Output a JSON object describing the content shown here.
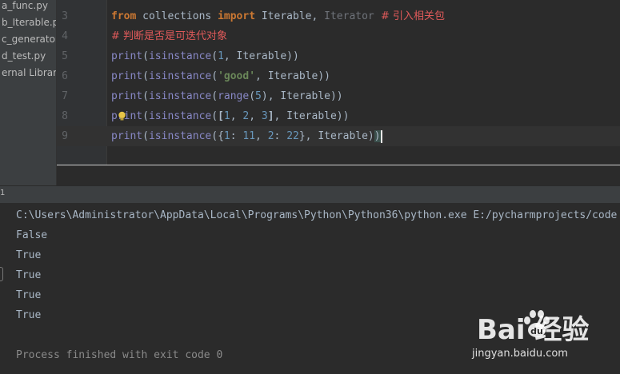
{
  "sidebar": {
    "items": [
      {
        "label": "a_func.py"
      },
      {
        "label": "b_Iterable.py"
      },
      {
        "label": "c_generator"
      },
      {
        "label": "d_test.py"
      },
      {
        "label": "ernal Librari"
      }
    ]
  },
  "editor": {
    "line_numbers": [
      "3",
      "4",
      "5",
      "6",
      "7",
      "8",
      "9"
    ],
    "lines": {
      "l3": {
        "kw1": "from",
        "mod": " collections ",
        "kw2": "import",
        "imp1": " Iterable",
        "sep": ", ",
        "imp2": "Iterator",
        "cmt": "  # 引入相关包"
      },
      "l4": {
        "cmt": "# 判断是否是可迭代对象"
      },
      "l5": {
        "fn": "print",
        "p1": "(",
        "fn2": "isinstance",
        "p2": "(",
        "num": "1",
        "rest": ", Iterable))"
      },
      "l6": {
        "fn": "print",
        "p1": "(",
        "fn2": "isinstance",
        "p2": "(",
        "str": "'good'",
        "rest": ", Iterable))"
      },
      "l7": {
        "fn": "print",
        "p1": "(",
        "fn2": "isinstance",
        "p2": "(",
        "fn3": "range",
        "p3": "(",
        "num": "5",
        "rest": "), Iterable))"
      },
      "l8": {
        "fn": "print",
        "p1": "(",
        "fn2": "isinstance",
        "p2": "(",
        "b1": "[",
        "n1": "1",
        "c1": ", ",
        "n2": "2",
        "c2": ", ",
        "n3": "3",
        "b2": "]",
        "rest": ", Iterable))"
      },
      "l9": {
        "fn": "print",
        "p1": "(",
        "fn2": "isinstance",
        "p2": "({",
        "n1": "1",
        "c1": ": ",
        "n2": "11",
        "c2": ", ",
        "n3": "2",
        "c3": ": ",
        "n4": "22",
        "rest": "}, Iterable)",
        "last": ")"
      }
    }
  },
  "run": {
    "tab_number": "1"
  },
  "console": {
    "command": "C:\\Users\\Administrator\\AppData\\Local\\Programs\\Python\\Python36\\python.exe E:/pycharmprojects/code",
    "output": [
      "False",
      "True",
      "True",
      "True",
      "True"
    ],
    "exit": "Process finished with exit code 0"
  },
  "watermark": {
    "brand": "Bai  经验",
    "sub": "jingyan.baidu.com"
  }
}
